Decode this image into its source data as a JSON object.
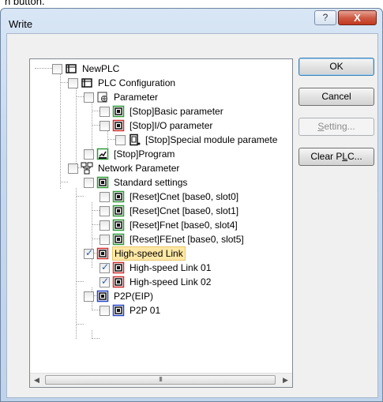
{
  "top_strip": {
    "text": "n button."
  },
  "window": {
    "title": "Write",
    "help_label": "?",
    "close_label": "X"
  },
  "buttons": {
    "ok": "OK",
    "cancel": "Cancel",
    "setting": "Setting...",
    "clear_plc": "Clear PLC..."
  },
  "tree": {
    "items": [
      {
        "label": "NewPLC",
        "checked": false,
        "icon": "plc-icon"
      },
      {
        "label": "PLC Configuration",
        "checked": false,
        "icon": "plc-icon"
      },
      {
        "label": "Parameter",
        "checked": false,
        "icon": "parameter-icon"
      },
      {
        "label": "[Stop]Basic parameter",
        "checked": false,
        "icon": "module-icon-green"
      },
      {
        "label": "[Stop]I/O parameter",
        "checked": false,
        "icon": "module-icon-red"
      },
      {
        "label": "[Stop]Special module paramete",
        "checked": false,
        "icon": "special-module-icon"
      },
      {
        "label": "[Stop]Program",
        "checked": false,
        "icon": "program-icon"
      },
      {
        "label": "Network Parameter",
        "checked": false,
        "icon": "network-icon"
      },
      {
        "label": "Standard settings",
        "checked": false,
        "icon": "module-icon-green"
      },
      {
        "label": "[Reset]Cnet [base0, slot0]",
        "checked": false,
        "icon": "module-icon-green"
      },
      {
        "label": "[Reset]Cnet [base0, slot1]",
        "checked": false,
        "icon": "module-icon-green"
      },
      {
        "label": "[Reset]Fnet [base0, slot4]",
        "checked": false,
        "icon": "module-icon-green"
      },
      {
        "label": "[Reset]FEnet [base0, slot5]",
        "checked": false,
        "icon": "module-icon-green"
      },
      {
        "label": "High-speed Link",
        "checked": true,
        "icon": "module-icon-red"
      },
      {
        "label": "High-speed Link 01",
        "checked": true,
        "icon": "module-icon-red"
      },
      {
        "label": "High-speed Link 02",
        "checked": true,
        "icon": "module-icon-red"
      },
      {
        "label": "P2P(EIP)",
        "checked": false,
        "icon": "module-icon-blue"
      },
      {
        "label": "P2P 01",
        "checked": false,
        "icon": "module-icon-blue"
      }
    ]
  },
  "scrollbar": {
    "left_arrow": "◀",
    "right_arrow": "▶",
    "grip": "III"
  },
  "colors": {
    "selection_bg": "#ffe8a6",
    "icon_green": "#2a9a34",
    "icon_red": "#d12a2a",
    "icon_blue": "#2440c8",
    "close_red": "#c1391f"
  }
}
